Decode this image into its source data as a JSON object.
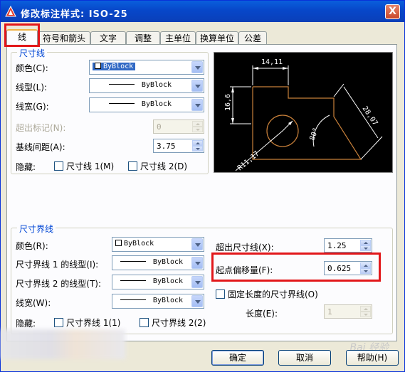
{
  "window": {
    "title": "修改标注样式: ISO-25",
    "close_label": "X"
  },
  "tabs": [
    {
      "label": "线",
      "active": true
    },
    {
      "label": "符号和箭头"
    },
    {
      "label": "文字"
    },
    {
      "label": "调整"
    },
    {
      "label": "主单位"
    },
    {
      "label": "换算单位"
    },
    {
      "label": "公差"
    }
  ],
  "dim_lines": {
    "title": "尺寸线",
    "color_label": "颜色(C):",
    "color_value": "ByBlock",
    "linetype_label": "线型(L):",
    "linetype_value": "ByBlock",
    "lineweight_label": "线宽(G):",
    "lineweight_value": "ByBlock",
    "extend_label": "超出标记(N):",
    "extend_value": "0",
    "baseline_label": "基线间距(A):",
    "baseline_value": "3.75",
    "suppress_label": "隐藏:",
    "suppress_1": "尺寸线 1(M)",
    "suppress_2": "尺寸线 2(D)"
  },
  "preview": {
    "dim_top": "14,11",
    "dim_left": "16,6",
    "dim_right": "28,07",
    "dim_angle": "80°",
    "dim_radius": "R11,17"
  },
  "ext_lines": {
    "title": "尺寸界线",
    "color_label": "颜色(R):",
    "color_value": "ByBlock",
    "linetype1_label": "尺寸界线 1 的线型(I):",
    "linetype1_value": "ByBlock",
    "linetype2_label": "尺寸界线 2 的线型(T):",
    "linetype2_value": "ByBlock",
    "lineweight_label": "线宽(W):",
    "lineweight_value": "ByBlock",
    "suppress_label": "隐藏:",
    "suppress_1": "尺寸界线 1(1)",
    "suppress_2": "尺寸界线 2(2)",
    "extend_label": "超出尺寸线(X):",
    "extend_value": "1.25",
    "offset_label": "起点偏移量(F):",
    "offset_value": "0.625",
    "fixed_label": "固定长度的尺寸界线(O)",
    "length_label": "长度(E):",
    "length_value": "1"
  },
  "buttons": {
    "ok": "确定",
    "cancel": "取消",
    "help": "帮助(H)"
  },
  "watermark": "Bai 经验",
  "colors": {
    "titlebar": "#0a5fdc",
    "highlight": "#e2171a",
    "group_title": "#0046d5",
    "preview_geometry": "#c8803a"
  }
}
